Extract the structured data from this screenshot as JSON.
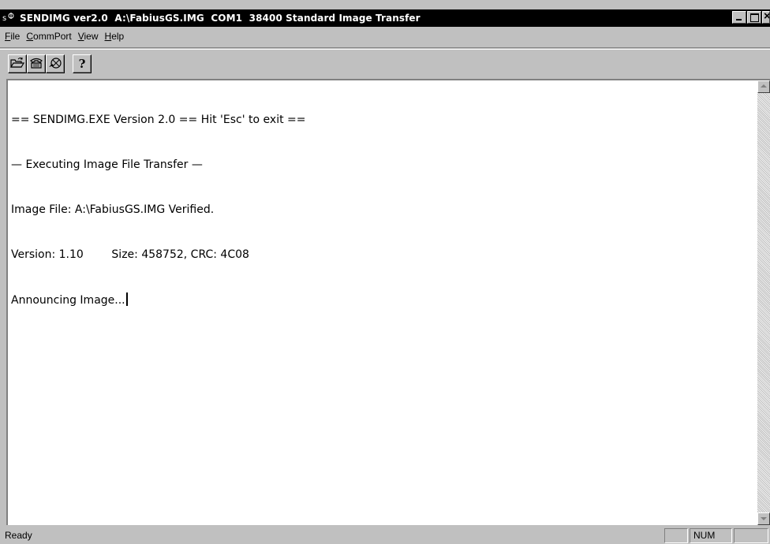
{
  "window": {
    "title": "SENDIMG ver2.0  A:\\FabiusGS.IMG  COM1  38400 Standard Image Transfer",
    "app_icon": "sendimg-icon",
    "controls": [
      "minimize-icon",
      "maximize-icon",
      "close-icon"
    ]
  },
  "menubar": {
    "items": [
      {
        "key": "F",
        "rest": "ile"
      },
      {
        "key": "C",
        "rest": "ommPort"
      },
      {
        "key": "V",
        "rest": "iew"
      },
      {
        "key": "H",
        "rest": "elp"
      }
    ]
  },
  "toolbar": {
    "buttons": [
      "open-folder-icon",
      "modem-icon",
      "transfer-icon",
      "help-icon"
    ],
    "help_glyph": "?"
  },
  "log": {
    "lines": [
      "== SENDIMG.EXE Version 2.0 == Hit 'Esc' to exit ==",
      "— Executing Image File Transfer —",
      "Image File: A:\\FabiusGS.IMG Verified.",
      "Version: 1.10        Size: 458752, CRC: 4C08",
      "Announcing Image..."
    ]
  },
  "statusbar": {
    "message": "Ready",
    "num_indicator": "NUM"
  },
  "colors": {
    "titlebar_bg": "#000000",
    "face": "#c0c0c0",
    "text_bg": "#ffffff"
  }
}
